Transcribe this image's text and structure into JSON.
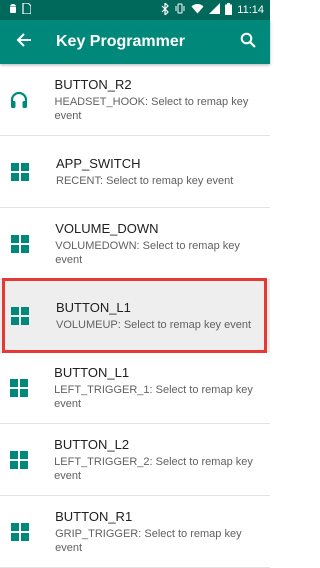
{
  "status_bar": {
    "time": "11:14",
    "left_icons": [
      "android-icon",
      "sim-icon"
    ],
    "right_icons": [
      "bluetooth-icon",
      "vibrate-icon",
      "wifi-icon",
      "signal-icon",
      "battery-icon"
    ]
  },
  "app_bar": {
    "title": "Key Programmer",
    "back_icon": "arrow-left-icon",
    "search_icon": "search-icon"
  },
  "colors": {
    "primary": "#00897b",
    "primary_dark": "#00695c",
    "highlight": "#e53935"
  },
  "items": [
    {
      "title": "BUTTON_R2",
      "subtitle": "HEADSET_HOOK: Select to remap key event",
      "icon": "headset-icon",
      "selected": false
    },
    {
      "title": "APP_SWITCH",
      "subtitle": "RECENT: Select to remap key event",
      "icon": "grid-icon",
      "selected": false
    },
    {
      "title": "VOLUME_DOWN",
      "subtitle": "VOLUMEDOWN: Select to remap key event",
      "icon": "grid-icon",
      "selected": false
    },
    {
      "title": "BUTTON_L1",
      "subtitle": "VOLUMEUP: Select to remap key event",
      "icon": "grid-icon",
      "selected": true
    },
    {
      "title": "BUTTON_L1",
      "subtitle": "LEFT_TRIGGER_1: Select to remap key event",
      "icon": "grid-icon",
      "selected": false
    },
    {
      "title": "BUTTON_L2",
      "subtitle": "LEFT_TRIGGER_2: Select to remap key event",
      "icon": "grid-icon",
      "selected": false
    },
    {
      "title": "BUTTON_R1",
      "subtitle": "GRIP_TRIGGER: Select to remap key event",
      "icon": "grid-icon",
      "selected": false
    }
  ]
}
